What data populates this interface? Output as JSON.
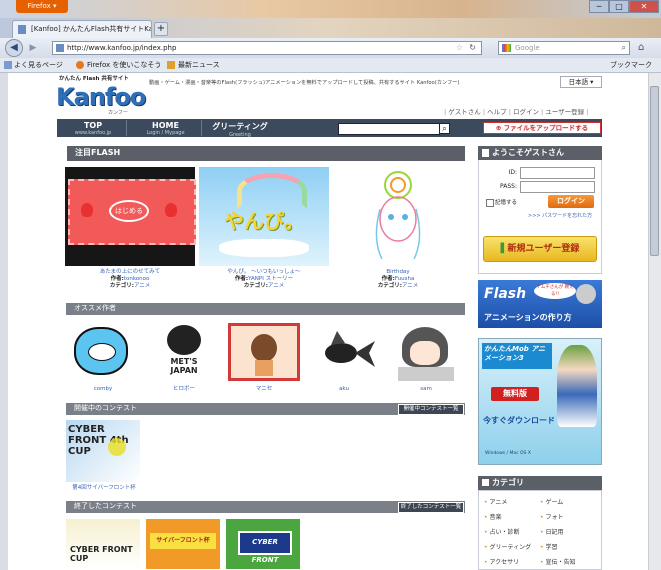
{
  "browser": {
    "menu_button": "Firefox ▾",
    "window_buttons": [
      "─",
      "□",
      "✕"
    ],
    "tab_title": "[Kanfoo] かんたんFlash共有サイトKa...",
    "newtab": "+",
    "url": "http://www.kanfoo.jp/index.php",
    "search_placeholder": "Google",
    "bookmarks": [
      "よく見るページ",
      "Firefox を使いこなそう",
      "最新ニュース"
    ],
    "bookmarks_menu": "ブックマーク"
  },
  "site": {
    "tagline_small": "かんたん Flash 共有サイト",
    "logo": "Kanfoo",
    "logo_sub": "カンフー",
    "description": "動画・ゲーム・漫画・音楽等のFlash(フラッシュ)アニメーションを無料でアップロードして投稿、共有するサイト Kanfoo(カンフー)",
    "language": "日本語 ▾",
    "user_links": [
      "ゲストさん",
      "ヘルプ",
      "ログイン",
      "ユーザー登録"
    ],
    "nav": [
      {
        "label": "TOP",
        "sub": "www.kanfoo.jp"
      },
      {
        "label": "HOME",
        "sub": "Login / Mypage"
      },
      {
        "label": "グリーティング",
        "sub": "Greeting"
      }
    ],
    "upload_button": "ファイルをアップロードする"
  },
  "featured": {
    "title": "注目FLASH",
    "items": [
      {
        "title": "あたまの上にのせてみて",
        "author_label": "作者:",
        "author": "tonkonoo",
        "cat_label": "カテゴリ:",
        "category": "アニメ",
        "thumb_text": "はじめる"
      },
      {
        "title": "やんぴ。 〜いつもいっしょ〜",
        "author_label": "作者:",
        "author": "YANPI ストーリー",
        "cat_label": "カテゴリ:",
        "category": "アニメ",
        "thumb_text": "やんぴ。"
      },
      {
        "title": "Birthday",
        "author_label": "作者:",
        "author": "Fuusha",
        "cat_label": "カテゴリ:",
        "category": "アニメ",
        "thumb_text": ""
      }
    ]
  },
  "recommended": {
    "title": "オススメ作者",
    "authors": [
      "comby",
      "ヒロボー",
      "マニセ",
      "aku",
      "sam"
    ]
  },
  "ongoing": {
    "title": "開催中のコンテスト",
    "more": "開催中コンテスト一覧",
    "items": [
      {
        "label": "第4回サイバーフロント杯",
        "thumb_text": "CYBER FRONT 4th CUP"
      }
    ]
  },
  "finished": {
    "title": "終了したコンテスト",
    "more": "終了したコンテスト一覧",
    "thumbs": [
      "CYBER FRONT CUP",
      "サイバーフロント杯",
      "CYBER FRONT"
    ]
  },
  "sidebar": {
    "welcome": "ようこそゲストさん",
    "id_label": "ID:",
    "pass_label": "PASS:",
    "remember": "記憶する",
    "login_button": "ログイン",
    "forgot": ">>> パスワードを忘れた方",
    "register_button": "新規ユーザー登録",
    "banner1_main": "Flash",
    "banner1_bubble": "ナムチさんが 教える!!",
    "banner1_sub": "アニメーションの作り方",
    "banner2_title": "かんたんMob アニメーション3",
    "banner2_badge": "無料版",
    "banner2_download": "今すぐダウンロード",
    "banner2_os": "Windows / Mac OS X",
    "category_title": "カテゴリ",
    "categories": [
      "アニメ",
      "ゲーム",
      "音楽",
      "フォト",
      "占い・診断",
      "日記用",
      "グリーティング",
      "学習",
      "アクセサリ",
      "宣伝・告知"
    ]
  }
}
